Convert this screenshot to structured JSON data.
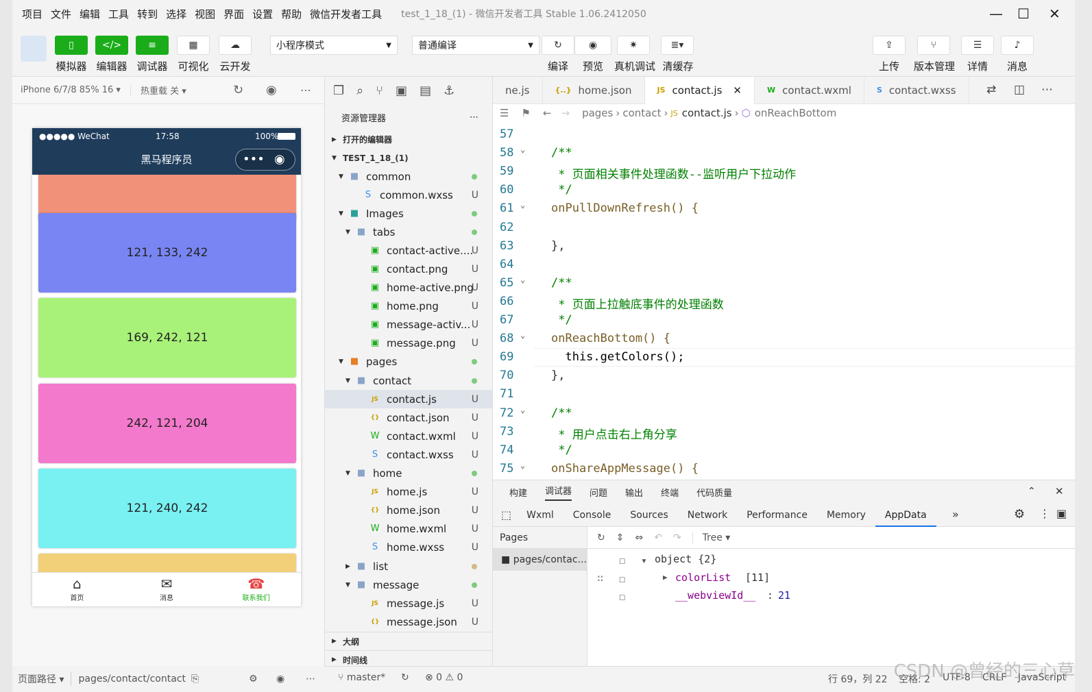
{
  "menus": [
    "项目",
    "文件",
    "编辑",
    "工具",
    "转到",
    "选择",
    "视图",
    "界面",
    "设置",
    "帮助",
    "微信开发者工具"
  ],
  "window_title": "test_1_18_(1)  -  微信开发者工具 Stable 1.06.2412050",
  "toolbar": {
    "simulator": "模拟器",
    "editor": "编辑器",
    "debugger": "调试器",
    "visual": "可视化",
    "cloud": "云开发",
    "mode_select": "小程序模式",
    "compile_select": "普通编译",
    "compile": "编译",
    "preview": "预览",
    "device_debug": "真机调试",
    "clear_cache": "清缓存",
    "upload": "上传",
    "version": "版本管理",
    "details": "详情",
    "messages": "消息"
  },
  "sim": {
    "device": "iPhone 6/7/8 85% 16 ▾",
    "hot_reload": "热重载 关 ▾",
    "status_carrier": "●●●●● WeChat",
    "status_time": "17:58",
    "status_battery": "100%",
    "nav_title": "黑马程序员",
    "cards": [
      {
        "label": "",
        "color": "#f2917a"
      },
      {
        "label": "121, 133, 242",
        "color": "#7985f2"
      },
      {
        "label": "169, 242, 121",
        "color": "#a9f279"
      },
      {
        "label": "242, 121, 204",
        "color": "#f279cc"
      },
      {
        "label": "121, 240, 242",
        "color": "#79f0f2"
      },
      {
        "label": "",
        "color": "#f2d079"
      }
    ],
    "tabs": [
      {
        "label": "首页",
        "icon": "home-icon"
      },
      {
        "label": "消息",
        "icon": "message-icon"
      },
      {
        "label": "联系我们",
        "icon": "phone-icon",
        "active": true
      }
    ],
    "footer_path_label": "页面路径 ▾",
    "footer_path": "pages/contact/contact"
  },
  "explorer": {
    "title": "资源管理器",
    "open_editors": "打开的编辑器",
    "project": "TEST_1_18_(1)",
    "outline": "大纲",
    "timeline": "时间线",
    "files": [
      {
        "name": "common",
        "type": "folder",
        "depth": 1,
        "open": true,
        "status": "dot"
      },
      {
        "name": "common.wxss",
        "type": "wxss",
        "depth": 2,
        "status": "U"
      },
      {
        "name": "Images",
        "type": "imgfolder",
        "depth": 1,
        "open": true,
        "status": "dot"
      },
      {
        "name": "tabs",
        "type": "folder",
        "depth": 2,
        "open": true,
        "status": "dot"
      },
      {
        "name": "contact-active....",
        "type": "png",
        "depth": 3,
        "status": "U"
      },
      {
        "name": "contact.png",
        "type": "png",
        "depth": 3,
        "status": "U"
      },
      {
        "name": "home-active.png",
        "type": "png",
        "depth": 3,
        "status": "U"
      },
      {
        "name": "home.png",
        "type": "png",
        "depth": 3,
        "status": "U"
      },
      {
        "name": "message-activ...",
        "type": "png",
        "depth": 3,
        "status": "U"
      },
      {
        "name": "message.png",
        "type": "png",
        "depth": 3,
        "status": "U"
      },
      {
        "name": "pages",
        "type": "pagesfolder",
        "depth": 1,
        "open": true,
        "status": "dot"
      },
      {
        "name": "contact",
        "type": "folder",
        "depth": 2,
        "open": true,
        "status": "dot"
      },
      {
        "name": "contact.js",
        "type": "js",
        "depth": 3,
        "status": "U",
        "active": true
      },
      {
        "name": "contact.json",
        "type": "json",
        "depth": 3,
        "status": "U"
      },
      {
        "name": "contact.wxml",
        "type": "wxml",
        "depth": 3,
        "status": "U"
      },
      {
        "name": "contact.wxss",
        "type": "wxss",
        "depth": 3,
        "status": "U"
      },
      {
        "name": "home",
        "type": "folder",
        "depth": 2,
        "open": true,
        "status": "dot"
      },
      {
        "name": "home.js",
        "type": "js",
        "depth": 3,
        "status": "U"
      },
      {
        "name": "home.json",
        "type": "json",
        "depth": 3,
        "status": "U"
      },
      {
        "name": "home.wxml",
        "type": "wxml",
        "depth": 3,
        "status": "U"
      },
      {
        "name": "home.wxss",
        "type": "wxss",
        "depth": 3,
        "status": "U"
      },
      {
        "name": "list",
        "type": "folder",
        "depth": 2,
        "open": false,
        "status": "dot2"
      },
      {
        "name": "message",
        "type": "folder",
        "depth": 2,
        "open": true,
        "status": "dot"
      },
      {
        "name": "message.js",
        "type": "js",
        "depth": 3,
        "status": "U"
      },
      {
        "name": "message.json",
        "type": "json",
        "depth": 3,
        "status": "U"
      }
    ]
  },
  "editor": {
    "tabs": [
      {
        "label": "ne.js",
        "icon": ""
      },
      {
        "label": "home.json",
        "icon": "{..}"
      },
      {
        "label": "contact.js",
        "icon": "JS",
        "active": true
      },
      {
        "label": "contact.wxml",
        "icon": "W"
      },
      {
        "label": "contact.wxss",
        "icon": "S"
      }
    ],
    "breadcrumb": [
      "pages",
      "contact",
      "contact.js",
      "onReachBottom"
    ],
    "lines": [
      {
        "n": "57",
        "text": ""
      },
      {
        "n": "58",
        "text": "/**",
        "cls": "cm",
        "fold": true
      },
      {
        "n": "59",
        "text": " * 页面相关事件处理函数--监听用户下拉动作",
        "cls": "cm"
      },
      {
        "n": "60",
        "text": " */",
        "cls": "cm"
      },
      {
        "n": "61",
        "text": "onPullDownRefresh() {",
        "cls": "fn",
        "fold": true
      },
      {
        "n": "62",
        "text": ""
      },
      {
        "n": "63",
        "text": "},",
        "cls": "pu"
      },
      {
        "n": "64",
        "text": ""
      },
      {
        "n": "65",
        "text": "/**",
        "cls": "cm",
        "fold": true
      },
      {
        "n": "66",
        "text": " * 页面上拉触底事件的处理函数",
        "cls": "cm"
      },
      {
        "n": "67",
        "text": " */",
        "cls": "cm"
      },
      {
        "n": "68",
        "text": "onReachBottom() {",
        "cls": "fn",
        "fold": true
      },
      {
        "n": "69",
        "text": "  this.getColors();",
        "cls": "tl"
      },
      {
        "n": "70",
        "text": "},",
        "cls": "pu"
      },
      {
        "n": "71",
        "text": ""
      },
      {
        "n": "72",
        "text": "/**",
        "cls": "cm",
        "fold": true
      },
      {
        "n": "73",
        "text": " * 用户点击右上角分享",
        "cls": "cm"
      },
      {
        "n": "74",
        "text": " */",
        "cls": "cm"
      },
      {
        "n": "75",
        "text": "onShareAppMessage() {",
        "cls": "fn",
        "fold": true
      }
    ]
  },
  "debugger": {
    "top_tabs": [
      "构建",
      "调试器",
      "问题",
      "输出",
      "终端",
      "代码质量"
    ],
    "tabs": [
      "Wxml",
      "Console",
      "Sources",
      "Network",
      "Performance",
      "Memory",
      "AppData"
    ],
    "pages_label": "Pages",
    "page_item": "pages/contac...",
    "tree_label": "Tree",
    "tree": {
      "root": "object {2}",
      "k1": "colorList",
      "k1_val": "[11]",
      "k2": "__webviewId__",
      "k2_val": "21"
    }
  },
  "footer": {
    "branch": "master*",
    "problems": "⊗ 0 ⚠ 0",
    "position": "行 69，列 22",
    "spaces": "空格: 2",
    "encoding": "UTF-8",
    "eol": "CRLF",
    "lang": "JavaScript",
    "watermark": "CSDN @曾经的三心草"
  }
}
